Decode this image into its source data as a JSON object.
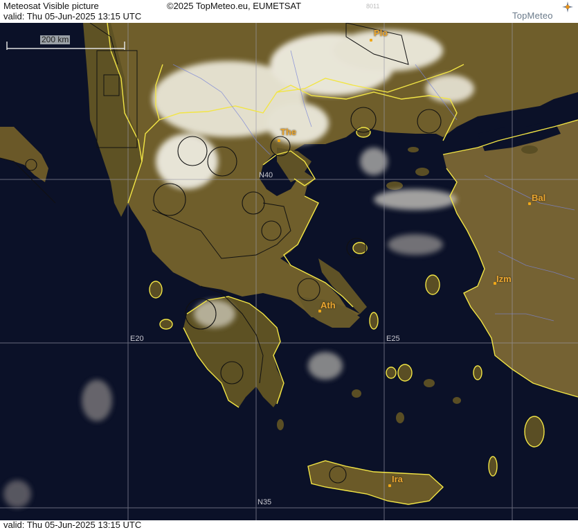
{
  "header": {
    "title": "Meteosat Visible picture",
    "valid": "valid:  Thu  05-Jun-2025  13:15 UTC",
    "copyright": "©2025 TopMeteo.eu, EUMETSAT",
    "code": "8011",
    "logo_text": "TopMeteo"
  },
  "footer": {
    "valid": "valid:  Thu  05-Jun-2025  13:15 UTC"
  },
  "map": {
    "scale_label": "200 km",
    "grid_labels": {
      "n40": "N40",
      "n35": "N35",
      "e20": "E20",
      "e25": "E25"
    },
    "cities": {
      "plo": "Plo",
      "the": "The",
      "bal": "Bal",
      "izm": "Izm",
      "ath": "Ath",
      "ira": "Ira"
    }
  },
  "colors": {
    "sea": "#0b1128",
    "land": "#6b5a2a",
    "border": "#f0e64a",
    "grid": "#9a9aa8",
    "city": "#e9a531",
    "cloud": "#f2f0e6"
  }
}
